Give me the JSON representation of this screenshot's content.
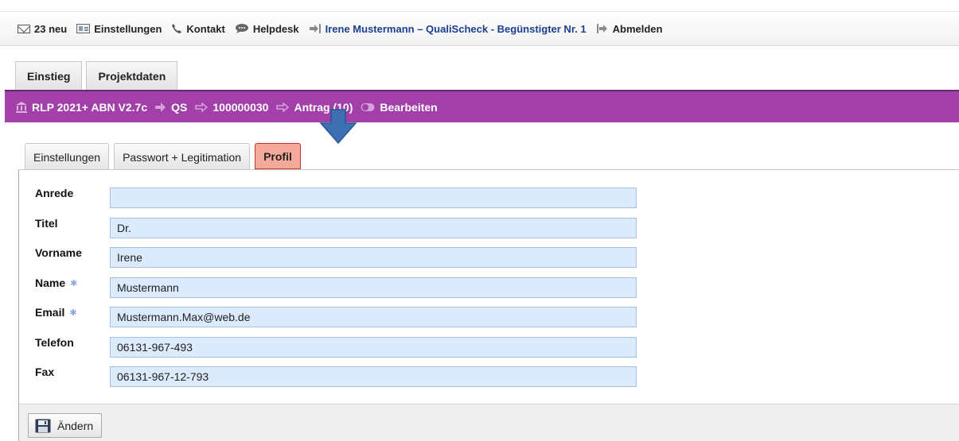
{
  "topbar": {
    "messages": "23 neu",
    "settings": "Einstellungen",
    "contact": "Kontakt",
    "helpdesk": "Helpdesk",
    "user": "Irene Mustermann – QualiScheck - Begünstigter Nr. 1",
    "logout": "Abmelden"
  },
  "main_tabs": [
    {
      "label": "Einstieg"
    },
    {
      "label": "Projektdaten"
    }
  ],
  "breadcrumb": {
    "program": "RLP 2021+ ABN V2.7c",
    "qs": "QS",
    "number": "100000030",
    "antrag": "Antrag (10)",
    "mode": "Bearbeiten"
  },
  "sub_tabs": [
    {
      "label": "Einstellungen"
    },
    {
      "label": "Passwort + Legitimation"
    },
    {
      "label": "Profil"
    }
  ],
  "form": {
    "anrede": {
      "label": "Anrede",
      "value": ""
    },
    "titel": {
      "label": "Titel",
      "value": "Dr."
    },
    "vorname": {
      "label": "Vorname",
      "value": "Irene"
    },
    "name": {
      "label": "Name",
      "value": "Mustermann"
    },
    "email": {
      "label": "Email",
      "value": "Mustermann.Max@web.de"
    },
    "telefon": {
      "label": "Telefon",
      "value": "06131-967-493"
    },
    "fax": {
      "label": "Fax",
      "value": "06131-967-12-793"
    }
  },
  "footer": {
    "save_label": "Ändern"
  },
  "colors": {
    "accent_purple": "#a23fa9",
    "active_tab": "#f4a99a",
    "input_bg": "#dbeafc",
    "user_link": "#1a3f8f",
    "arrow_blue": "#3d6fb3"
  },
  "icons": [
    "mail-icon",
    "card-icon",
    "phone-icon",
    "chat-icon",
    "login-arrow-icon",
    "logout-icon",
    "bank-icon",
    "arrow-right-icon",
    "hand-point-icon",
    "toggle-icon",
    "save-disk-icon",
    "down-arrow-annotation"
  ]
}
